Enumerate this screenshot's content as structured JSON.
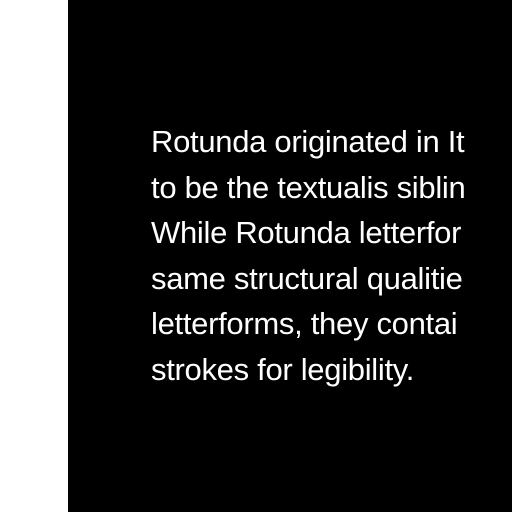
{
  "text": {
    "lines": [
      "Rotunda originated in It",
      "to be the textualis siblin",
      "While Rotunda letterfor",
      "same structural qualitie",
      "letterforms, they contai",
      "strokes for legibility."
    ]
  }
}
